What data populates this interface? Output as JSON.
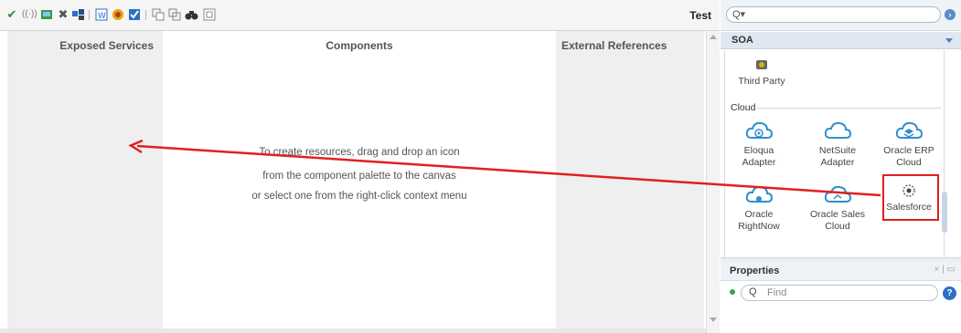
{
  "toolbar": {
    "icons": [
      "check-icon",
      "wifi-icon",
      "image-icon",
      "delete-icon",
      "deploy-icon",
      "wsdl-icon",
      "security-icon",
      "validate-icon",
      "copy-icon",
      "paste-icon",
      "find-icon",
      "schema-icon"
    ],
    "test_label": "Test"
  },
  "swimlanes": {
    "exposed_services": "Exposed Services",
    "components": "Components",
    "external_references": "External References"
  },
  "hint": {
    "line1": "To create resources, drag and drop an icon",
    "line2": "from the component palette to the canvas",
    "line3": "or select one from the right-click context menu"
  },
  "palette": {
    "search_glyph": "Q▾",
    "category": "SOA",
    "third_party_label": "Third Party",
    "cloud_group": "Cloud",
    "items": [
      {
        "line1": "Eloqua",
        "line2": "Adapter",
        "icon": "cloud-target-icon"
      },
      {
        "line1": "NetSuite",
        "line2": "Adapter",
        "icon": "cloud-icon"
      },
      {
        "line1": "Oracle ERP",
        "line2": "Cloud",
        "icon": "cloud-stack-icon"
      },
      {
        "line1": "Oracle",
        "line2": "RightNow",
        "icon": "cloud-rightnow-icon"
      },
      {
        "line1": "Oracle Sales",
        "line2": "Cloud",
        "icon": "cloud-sales-icon"
      },
      {
        "line1": "Salesforce",
        "line2": "",
        "icon": "salesforce-icon"
      }
    ]
  },
  "properties": {
    "title": "Properties",
    "find_placeholder": "Find",
    "help": "?"
  },
  "colors": {
    "annotation_red": "#e02020",
    "cloud_blue": "#2f8fd0"
  }
}
